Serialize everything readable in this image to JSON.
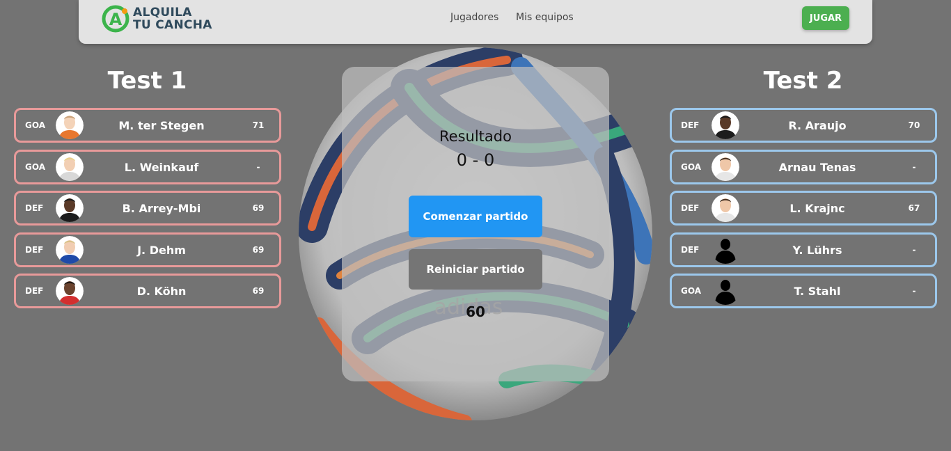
{
  "nav": {
    "logo_line1": "ALQUILA",
    "logo_line2": "TU CANCHA",
    "links": [
      "Jugadores",
      "Mis equipos"
    ],
    "play_button": "JUGAR"
  },
  "colors": {
    "brand_green": "#4caf50",
    "team1_border": "#e89a9a",
    "team2_border": "#9cc8ec",
    "start_button": "#2196f3",
    "reset_button": "#757575"
  },
  "team1": {
    "name": "Test 1",
    "players": [
      {
        "pos": "GOA",
        "name": "M. ter Stegen",
        "rating": "71",
        "avatar": "photo-orange-kit"
      },
      {
        "pos": "GOA",
        "name": "L. Weinkauf",
        "rating": "-",
        "avatar": "photo-blond"
      },
      {
        "pos": "DEF",
        "name": "B. Arrey-Mbi",
        "rating": "69",
        "avatar": "photo-dark"
      },
      {
        "pos": "DEF",
        "name": "J. Dehm",
        "rating": "69",
        "avatar": "photo-blue-kit"
      },
      {
        "pos": "DEF",
        "name": "D. Köhn",
        "rating": "69",
        "avatar": "photo-red-kit"
      }
    ]
  },
  "team2": {
    "name": "Test 2",
    "players": [
      {
        "pos": "DEF",
        "name": "R. Araujo",
        "rating": "70",
        "avatar": "photo-dark"
      },
      {
        "pos": "GOA",
        "name": "Arnau Tenas",
        "rating": "-",
        "avatar": "photo-light"
      },
      {
        "pos": "DEF",
        "name": "L. Krajnc",
        "rating": "67",
        "avatar": "photo-light"
      },
      {
        "pos": "DEF",
        "name": "Y. Lührs",
        "rating": "-",
        "avatar": "silhouette"
      },
      {
        "pos": "GOA",
        "name": "T. Stahl",
        "rating": "-",
        "avatar": "silhouette"
      }
    ]
  },
  "match": {
    "result_label": "Resultado",
    "score": "0 - 0",
    "start_button": "Comenzar partido",
    "reset_button": "Reiniciar partido",
    "timer": "60"
  }
}
